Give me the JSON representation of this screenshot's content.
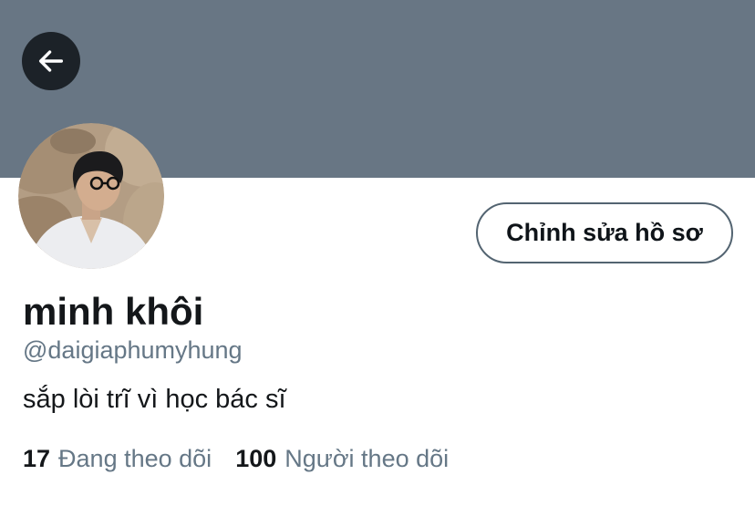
{
  "header": {
    "banner_color": "#687684",
    "back_icon": "arrow-left-icon"
  },
  "profile": {
    "avatar_icon": "profile-photo",
    "display_name": "minh khôi",
    "handle": "@daigiaphumyhung",
    "bio": "sắp lòi trĩ vì học bác sĩ",
    "edit_label": "Chỉnh sửa hồ sơ"
  },
  "stats": [
    {
      "count": "17",
      "label": "Đang theo dõi"
    },
    {
      "count": "100",
      "label": "Người theo dõi"
    }
  ],
  "colors": {
    "text_primary": "#14171a",
    "text_secondary": "#657786",
    "button_border": "#536471"
  }
}
